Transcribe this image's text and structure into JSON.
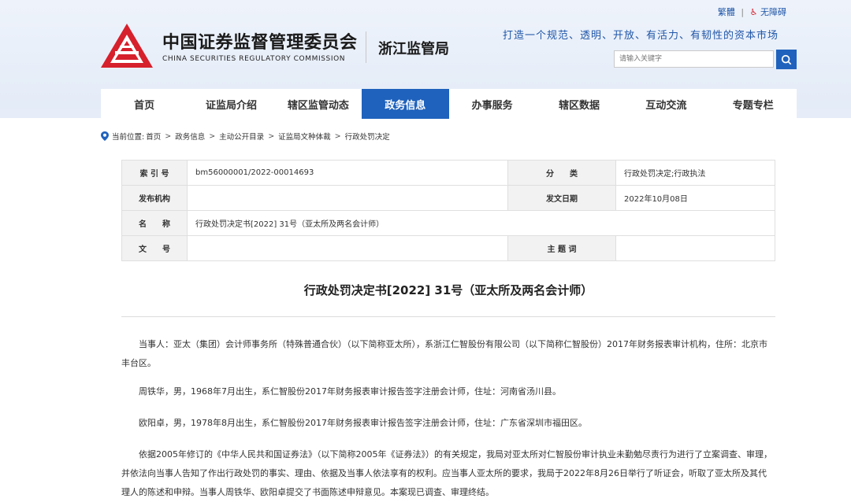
{
  "top_links": {
    "traditional": "繁體",
    "separator": "|",
    "accessibility": "无障碍"
  },
  "brand": {
    "name_cn": "中国证券监督管理委员会",
    "name_en": "CHINA SECURITIES REGULATORY COMMISSION",
    "bureau": "浙江监管局",
    "logo_color": "#d6202c"
  },
  "slogan": "打造一个规范、透明、开放、有活力、有韧性的资本市场",
  "search": {
    "placeholder": "请输入关键字"
  },
  "nav": {
    "items": [
      "首页",
      "证监局介绍",
      "辖区监管动态",
      "政务信息",
      "办事服务",
      "辖区数据",
      "互动交流",
      "专题专栏"
    ],
    "active_index": 3,
    "active_color": "#1f62bd"
  },
  "breadcrumb": {
    "prefix": "当前位置:",
    "items": [
      "首页",
      "政务信息",
      "主动公开目录",
      "证监局文种体裁",
      "行政处罚决定"
    ]
  },
  "meta": {
    "index_no_label": "索 引 号",
    "index_no": "bm56000001/2022-00014693",
    "category_label": "分　　类",
    "category": "行政处罚决定;行政执法",
    "issuer_label": "发布机构",
    "issuer": "",
    "date_label": "发文日期",
    "date": "2022年10月08日",
    "name_label": "名　　称",
    "name": "行政处罚决定书[2022] 31号（亚太所及两名会计师）",
    "docno_label": "文　　号",
    "docno": "",
    "keywords_label": "主 题 词",
    "keywords": ""
  },
  "document": {
    "title": "行政处罚决定书[2022] 31号（亚太所及两名会计师）",
    "paragraphs": [
      "当事人：亚太（集团）会计师事务所（特殊普通合伙）（以下简称亚太所），系浙江仁智股份有限公司（以下简称仁智股份）2017年财务报表审计机构，住所：北京市丰台区。",
      "周铁华，男，1968年7月出生，系仁智股份2017年财务报表审计报告签字注册会计师，住址：河南省汤川县。",
      "欧阳卓，男，1978年8月出生，系仁智股份2017年财务报表审计报告签字注册会计师，住址：广东省深圳市福田区。",
      "依据2005年修订的《中华人民共和国证券法》（以下简称2005年《证券法》）的有关规定，我局对亚太所对仁智股份审计执业未勤勉尽责行为进行了立案调查、审理，并依法向当事人告知了作出行政处罚的事实、理由、依据及当事人依法享有的权利。应当事人亚太所的要求，我局于2022年8月26日举行了听证会，听取了亚太所及其代理人的陈述和申辩。当事人周铁华、欧阳卓提交了书面陈述申辩意见。本案现已调查、审理终结。"
    ]
  }
}
